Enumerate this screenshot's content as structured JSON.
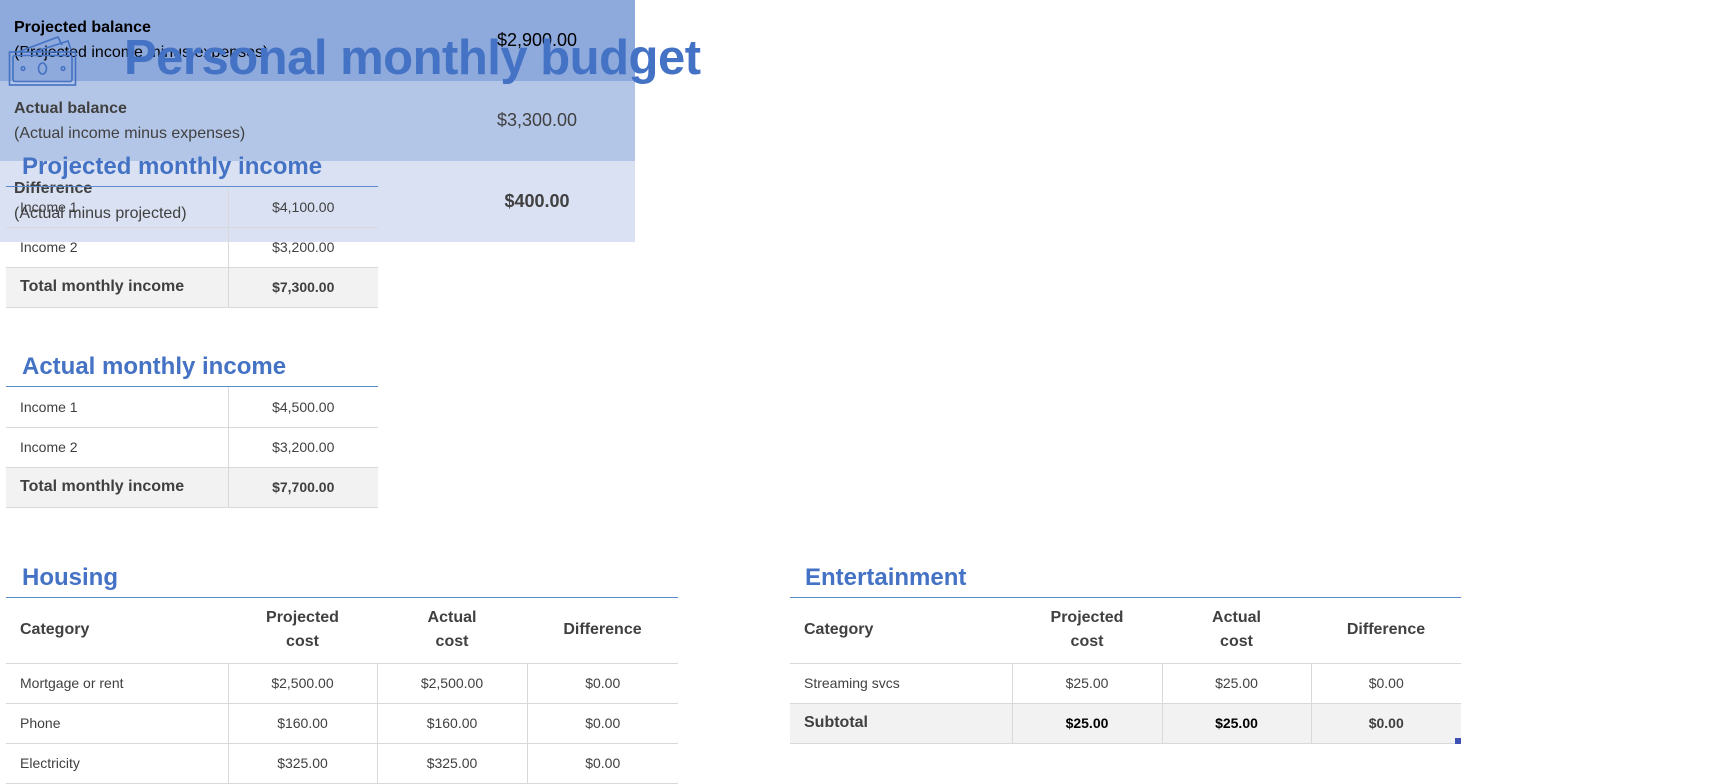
{
  "title": "Personal monthly budget",
  "projected_income": {
    "heading": "Projected monthly income",
    "rows": [
      {
        "label": "Income 1",
        "value": "$4,100.00"
      },
      {
        "label": "Income 2",
        "value": "$3,200.00"
      }
    ],
    "total": {
      "label": "Total monthly income",
      "value": "$7,300.00"
    }
  },
  "actual_income": {
    "heading": "Actual monthly income",
    "rows": [
      {
        "label": "Income 1",
        "value": "$4,500.00"
      },
      {
        "label": "Income 2",
        "value": "$3,200.00"
      }
    ],
    "total": {
      "label": "Total monthly income",
      "value": "$7,700.00"
    }
  },
  "balance": [
    {
      "label": "Projected balance",
      "sub": "(Projected income minus expenses)",
      "value": "$2,900.00",
      "color": "#8EA9DB"
    },
    {
      "label": "Actual balance",
      "sub": "(Actual income minus expenses)",
      "value": "$3,300.00",
      "color": "#B4C6E7"
    },
    {
      "label": "Difference",
      "sub": "(Actual minus projected)",
      "value": "$400.00",
      "color": "#D9E1F2"
    }
  ],
  "columns": {
    "category": "Category",
    "projected_1": "Projected",
    "projected_2": "cost",
    "actual_1": "Actual",
    "actual_2": "cost",
    "difference": "Difference"
  },
  "housing": {
    "heading": "Housing",
    "rows": [
      {
        "category": "Mortgage or rent",
        "projected": "$2,500.00",
        "actual": "$2,500.00",
        "difference": "$0.00"
      },
      {
        "category": "Phone",
        "projected": "$160.00",
        "actual": "$160.00",
        "difference": "$0.00"
      },
      {
        "category": "Electricity",
        "projected": "$325.00",
        "actual": "$325.00",
        "difference": "$0.00"
      }
    ]
  },
  "entertainment": {
    "heading": "Entertainment",
    "rows": [
      {
        "category": "Streaming svcs",
        "projected": "$25.00",
        "actual": "$25.00",
        "difference": "$0.00"
      }
    ],
    "subtotal": {
      "category": "Subtotal",
      "projected": "$25.00",
      "actual": "$25.00",
      "difference": "$0.00"
    }
  }
}
